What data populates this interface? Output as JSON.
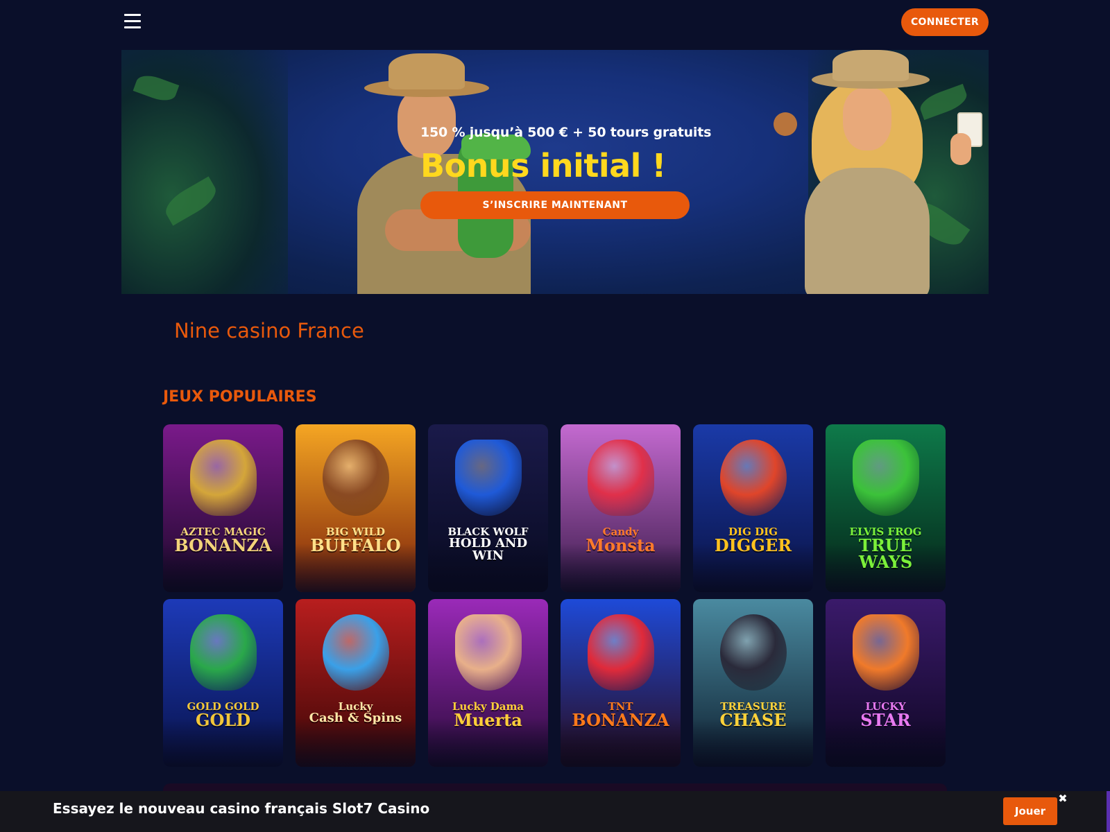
{
  "header": {
    "menu_icon": "hamburger-menu-icon",
    "login_label": "CONNECTER"
  },
  "banner": {
    "promo_subtitle": "150 % jusqu’à 500 € + 50 tours gratuits",
    "promo_title": "Bonus initial !",
    "signup_label": "S’INSCRIRE MAINTENANT"
  },
  "site_title": "Nine casino France",
  "popular": {
    "heading": "JEUX POPULAIRES",
    "games": [
      {
        "line1": "AZTEC MAGIC",
        "line2": "BONANZA",
        "bg_top": "#7a1a8a",
        "bg_bottom": "#1a0828",
        "logo_color": "#f3d37a",
        "motif": "#d4a63a"
      },
      {
        "line1": "BIG WILD",
        "line2": "BUFFALO",
        "bg_top": "#f5a623",
        "bg_bottom": "#7a1f0a",
        "logo_color": "#ffe08a",
        "motif": "#8a4a22"
      },
      {
        "line1": "BLACK WOLF",
        "line2": "HOLD AND WIN",
        "bg_top": "#1a1a4a",
        "bg_bottom": "#080a20",
        "logo_color": "#ffffff",
        "motif": "#1f5ad8"
      },
      {
        "line1": "Candy",
        "line2": "Monsta",
        "bg_top": "#c46ad0",
        "bg_bottom": "#3a1a4a",
        "logo_color": "#ff7a2a",
        "motif": "#e0304a"
      },
      {
        "line1": "DIG DIG",
        "line2": "DIGGER",
        "bg_top": "#1a3aa8",
        "bg_bottom": "#0a1244",
        "logo_color": "#ffc21e",
        "motif": "#e0452a"
      },
      {
        "line1": "ELVIS FROG",
        "line2": "TRUE WAYS",
        "bg_top": "#0e7a4a",
        "bg_bottom": "#052418",
        "logo_color": "#7cf03a",
        "motif": "#3cc23a"
      },
      {
        "line1": "GOLD GOLD",
        "line2": "GOLD",
        "bg_top": "#1d3ab8",
        "bg_bottom": "#08124a",
        "logo_color": "#f3c73a",
        "motif": "#2aa84a"
      },
      {
        "line1": "Lucky",
        "line2": "Cash & Spins",
        "bg_top": "#b81e1e",
        "bg_bottom": "#3a0606",
        "logo_color": "#ffe7a8",
        "motif": "#3aa0e8"
      },
      {
        "line1": "Lucky Dama",
        "line2": "Muerta",
        "bg_top": "#9a2ab8",
        "bg_bottom": "#2a0a3a",
        "logo_color": "#ffcf3a",
        "motif": "#e8b08a"
      },
      {
        "line1": "TNT",
        "line2": "BONANZA",
        "bg_top": "#1e4ad8",
        "bg_bottom": "#2a0a1a",
        "logo_color": "#ff7a1a",
        "motif": "#e02a3a"
      },
      {
        "line1": "TREASURE",
        "line2": "CHASE",
        "bg_top": "#4a8aa0",
        "bg_bottom": "#0e2030",
        "logo_color": "#ffd23a",
        "motif": "#2a2a3a"
      },
      {
        "line1": "LUCKY",
        "line2": "STAR",
        "bg_top": "#3a1a6a",
        "bg_bottom": "#0e0622",
        "logo_color": "#e87af0",
        "motif": "#f07a2a"
      }
    ]
  },
  "promo_bar": {
    "text": "Essayez le nouveau casino français Slot7 Casino",
    "play_label": "Jouer",
    "close_label": "✖"
  },
  "colors": {
    "accent": "#e8590c",
    "page_bg": "#0a0f2a",
    "promo_yellow": "#ffd81e"
  }
}
